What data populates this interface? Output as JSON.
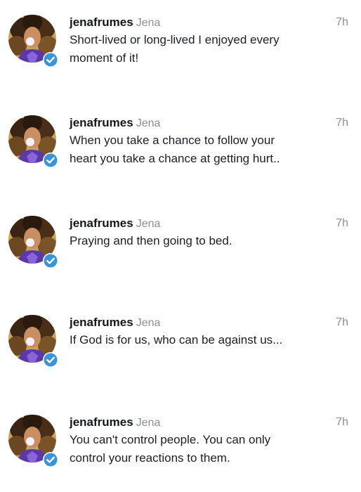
{
  "accent_color": "#3b94d9",
  "tweets": [
    {
      "handle": "jenafrumes",
      "name": "Jena",
      "time": "7h",
      "verified": true,
      "lines": [
        "Short-lived or long-lived I enjoyed every",
        "moment of it!"
      ]
    },
    {
      "handle": "jenafrumes",
      "name": "Jena",
      "time": "7h",
      "verified": true,
      "lines": [
        "When you take a chance to follow your",
        "heart you take a chance at getting hurt.."
      ]
    },
    {
      "handle": "jenafrumes",
      "name": "Jena",
      "time": "7h",
      "verified": true,
      "lines": [
        "Praying and then going to bed."
      ]
    },
    {
      "handle": "jenafrumes",
      "name": "Jena",
      "time": "7h",
      "verified": true,
      "lines": [
        "If God is for us, who can be against us..."
      ]
    },
    {
      "handle": "jenafrumes",
      "name": "Jena",
      "time": "7h",
      "verified": true,
      "lines": [
        "You can't control people. You can only",
        "control your reactions to them."
      ]
    }
  ]
}
